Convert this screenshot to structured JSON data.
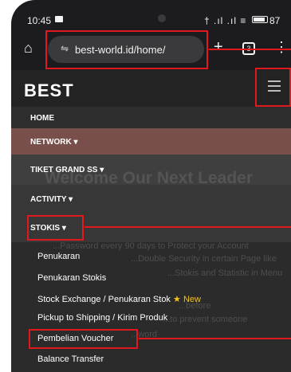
{
  "status_bar": {
    "time": "10:45",
    "signal_icons": "† .ıl .ıl ≡",
    "battery_pct": "87"
  },
  "browser": {
    "home_icon": "⌂",
    "url": "best-world.id/home/",
    "new_tab_icon": "+",
    "tab_count": "3",
    "more_icon": "⋮"
  },
  "site": {
    "logo": "BEST",
    "background_title": "Welcome Our Next Leader",
    "background_lines": [
      "...Password every 90 days to Protect your Account",
      "...Double Security in certain Page like",
      "...Stokis and Statistic in Menu",
      "...before",
      "...to prevent someone",
      "...word"
    ]
  },
  "nav": {
    "home": "HOME",
    "network": "NETWORK ▾",
    "tiket": "TIKET GRAND SS ▾",
    "activity": "ACTIVITY ▾",
    "stokis": "STOKIS ▾"
  },
  "stokis_menu": {
    "penukaran": "Penukaran",
    "penukaran_stokis": "Penukaran Stokis",
    "stock_exchange": "Stock Exchange / Penukaran Stok",
    "new_star": "★",
    "new_label": "New",
    "pickup": "Pickup to Shipping / Kirim Produk",
    "pembelian_voucher": "Pembelian Voucher",
    "balance_transfer": "Balance Transfer"
  },
  "colors": {
    "highlight": "#e0191e",
    "network_bg": "#80524e",
    "accent_new": "#f5c518"
  }
}
